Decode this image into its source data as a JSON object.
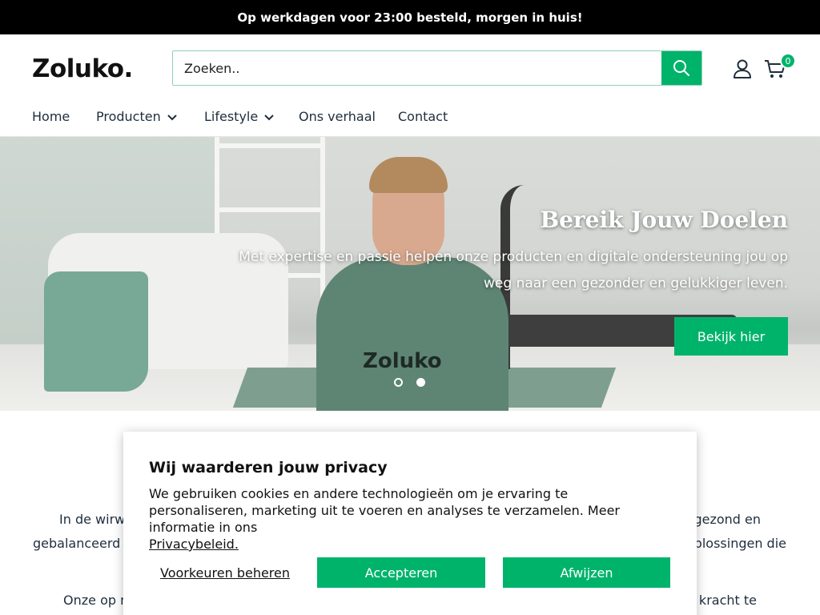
{
  "announcement": {
    "text": "Op werkdagen voor 23:00 besteld, morgen in huis!"
  },
  "header": {
    "logo": "Zoluko.",
    "search": {
      "placeholder": "Zoeken.."
    },
    "cart_count": "0"
  },
  "nav": {
    "items": [
      {
        "label": "Home",
        "has_dropdown": false
      },
      {
        "label": "Producten",
        "has_dropdown": true
      },
      {
        "label": "Lifestyle",
        "has_dropdown": true
      },
      {
        "label": "Ons verhaal",
        "has_dropdown": false
      },
      {
        "label": "Contact",
        "has_dropdown": false
      }
    ]
  },
  "hero": {
    "title": "Bereik Jouw Doelen",
    "subtitle": "Met expertise en passie helpen onze producten en digitale ondersteuning jou op weg naar een gezonder en gelukkiger leven.",
    "button": "Bekijk hier",
    "shirt_text": "Zoluko",
    "slide_count": 2,
    "active_slide": 2
  },
  "content": {
    "p1_left": "In de wirwa",
    "p1_right": "gezond en",
    "p1b_left": "gebalanceerd le",
    "p1b_right": "oplossingen die",
    "p2_left": "Onze op n",
    "p2_right": "e kracht te"
  },
  "cookie": {
    "title": "Wij waarderen jouw privacy",
    "text": "We gebruiken cookies en andere technologieën om je ervaring te personaliseren, marketing uit te voeren en analyses te verzamelen. Meer informatie in ons",
    "link": "Privacybeleid.",
    "preferences": "Voorkeuren beheren",
    "accept": "Accepteren",
    "reject": "Afwijzen"
  },
  "colors": {
    "accent": "#00b36b",
    "announcement_bg": "#000000"
  }
}
